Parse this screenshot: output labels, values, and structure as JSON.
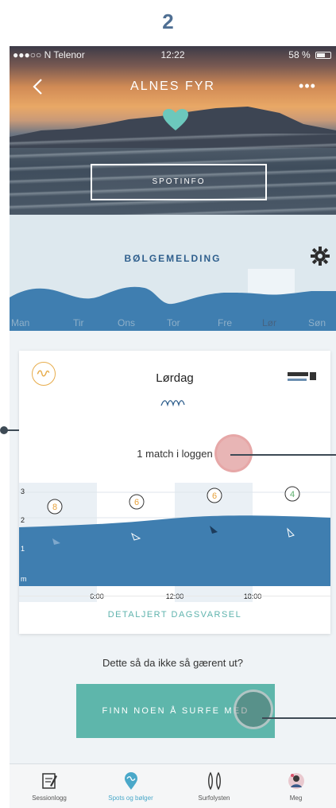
{
  "step_number": "2",
  "status_bar": {
    "carrier": "●●●○○ N Telenor",
    "time": "12:22",
    "battery": "58 %"
  },
  "header": {
    "title": "ALNES FYR",
    "more": "•••",
    "spotinfo_label": "SPOTINFO"
  },
  "forecast": {
    "title": "BØLGEMELDING",
    "days": [
      "Man",
      "Tir",
      "Ons",
      "Tor",
      "Fre",
      "Lør",
      "Søn"
    ],
    "selected_day": "Lør"
  },
  "day_card": {
    "day": "Lørdag",
    "surf_forecast_logo": "SURF-FORECAST",
    "match_text": "1 match i loggen",
    "y_axis": [
      "3",
      "2",
      "1",
      "m"
    ],
    "times": [
      "6:00",
      "12:00",
      "18:00"
    ],
    "wind_values": [
      "8",
      "6",
      "6",
      "4"
    ],
    "detail_link": "DETALJERT DAGSVARSEL"
  },
  "prompt_text": "Dette så da ikke så gærent ut?",
  "find_button_label": "FINN NOEN Å SURFE MED",
  "tabbar": {
    "items": [
      {
        "label": "Sessionlogg",
        "icon": "notebook-icon"
      },
      {
        "label": "Spots og bølger",
        "icon": "location-pin-icon"
      },
      {
        "label": "Surfolysten",
        "icon": "surf-gear-icon"
      },
      {
        "label": "Meg",
        "icon": "avatar-icon"
      }
    ],
    "active_index": 1
  },
  "colors": {
    "accent_teal": "#5eb6ab",
    "wave_blue": "#3f7eb0",
    "title_blue": "#2f5f8d",
    "active_tab": "#4aa8c9"
  }
}
